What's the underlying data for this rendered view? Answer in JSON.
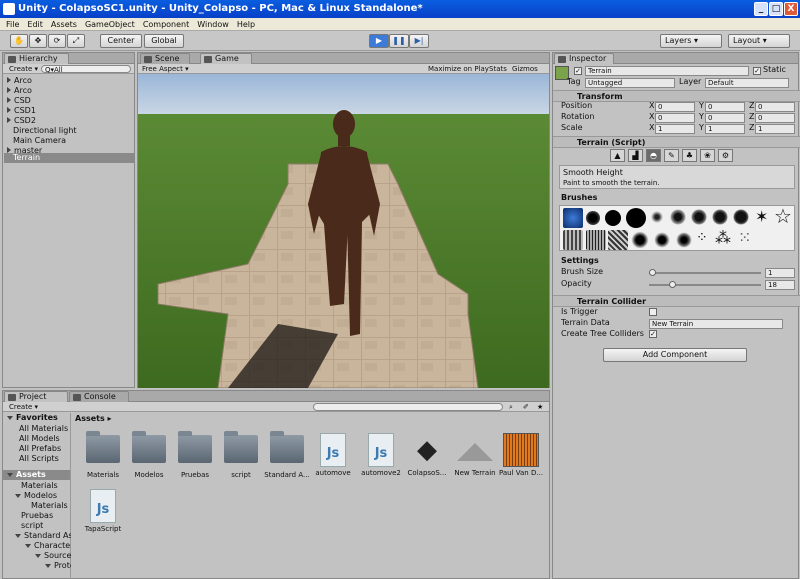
{
  "window": {
    "title": "Unity - ColapsoSC1.unity - Unity_Colapso - PC, Mac & Linux Standalone*",
    "minimize": "_",
    "maximize": "□",
    "close": "X"
  },
  "menu": [
    "File",
    "Edit",
    "Assets",
    "GameObject",
    "Component",
    "Window",
    "Help"
  ],
  "toolbar": {
    "center": "Center",
    "global": "Global",
    "layers": "Layers",
    "layout": "Layout"
  },
  "hierarchy": {
    "tab": "Hierarchy",
    "create": "Create",
    "search": "Q▾All",
    "items": [
      "Arco",
      "Arco",
      "CSD",
      "CSD1",
      "CSD2",
      "Directional light",
      "Main Camera",
      "master",
      "Terrain"
    ]
  },
  "scene_tab": "Scene",
  "game_tab": "Game",
  "game": {
    "aspect": "Free Aspect",
    "max": "Maximize on Play",
    "stats": "Stats",
    "gizmos": "Gizmos"
  },
  "inspector": {
    "tab": "Inspector",
    "name": "Terrain",
    "static": "Static",
    "tag_label": "Tag",
    "tag": "Untagged",
    "layer_label": "Layer",
    "layer": "Default",
    "transform": {
      "title": "Transform",
      "rows": [
        {
          "label": "Position",
          "x": "0",
          "y": "0",
          "z": "0"
        },
        {
          "label": "Rotation",
          "x": "0",
          "y": "0",
          "z": "0"
        },
        {
          "label": "Scale",
          "x": "1",
          "y": "1",
          "z": "1"
        }
      ]
    },
    "terrain": {
      "title": "Terrain (Script)",
      "mode": "Smooth Height",
      "hint": "Paint to smooth the terrain.",
      "brushes": "Brushes",
      "settings": "Settings",
      "brush_size_label": "Brush Size",
      "brush_size": "1",
      "opacity_label": "Opacity",
      "opacity": "18",
      "brush_size_level": 0.01,
      "opacity_level": 0.18
    },
    "collider": {
      "title": "Terrain Collider",
      "trigger": "Is Trigger",
      "data_label": "Terrain Data",
      "data": "New Terrain",
      "trees": "Create Tree Colliders",
      "trees_check": "✓"
    },
    "add": "Add Component"
  },
  "project": {
    "tab": "Project",
    "console": "Console",
    "create": "Create",
    "favorites": "Favorites",
    "fav_items": [
      "All Materials",
      "All Models",
      "All Prefabs",
      "All Scripts"
    ],
    "assets": "Assets",
    "tree": [
      "Materials",
      "Modelos",
      "Materials",
      "Pruebas",
      "script",
      "Standard Assets",
      "Characters",
      "Sources",
      "Prototype"
    ],
    "breadcrumb": "Assets ▸",
    "files": [
      {
        "name": "Materials",
        "kind": "folder"
      },
      {
        "name": "Modelos",
        "kind": "folder"
      },
      {
        "name": "Pruebas",
        "kind": "folder"
      },
      {
        "name": "script",
        "kind": "folder"
      },
      {
        "name": "Standard A...",
        "kind": "folder"
      },
      {
        "name": "automove",
        "kind": "js"
      },
      {
        "name": "automove2",
        "kind": "js"
      },
      {
        "name": "ColapsoS...",
        "kind": "unity"
      },
      {
        "name": "New Terrain",
        "kind": "terrain"
      },
      {
        "name": "Paul Van D...",
        "kind": "audio"
      },
      {
        "name": "TapaScript",
        "kind": "js"
      }
    ]
  },
  "colors": {
    "titlebar": "#0a5ee0",
    "selection": "#3d7bd9",
    "sky": "#9db9d9",
    "grass": "#4a7a2a"
  }
}
